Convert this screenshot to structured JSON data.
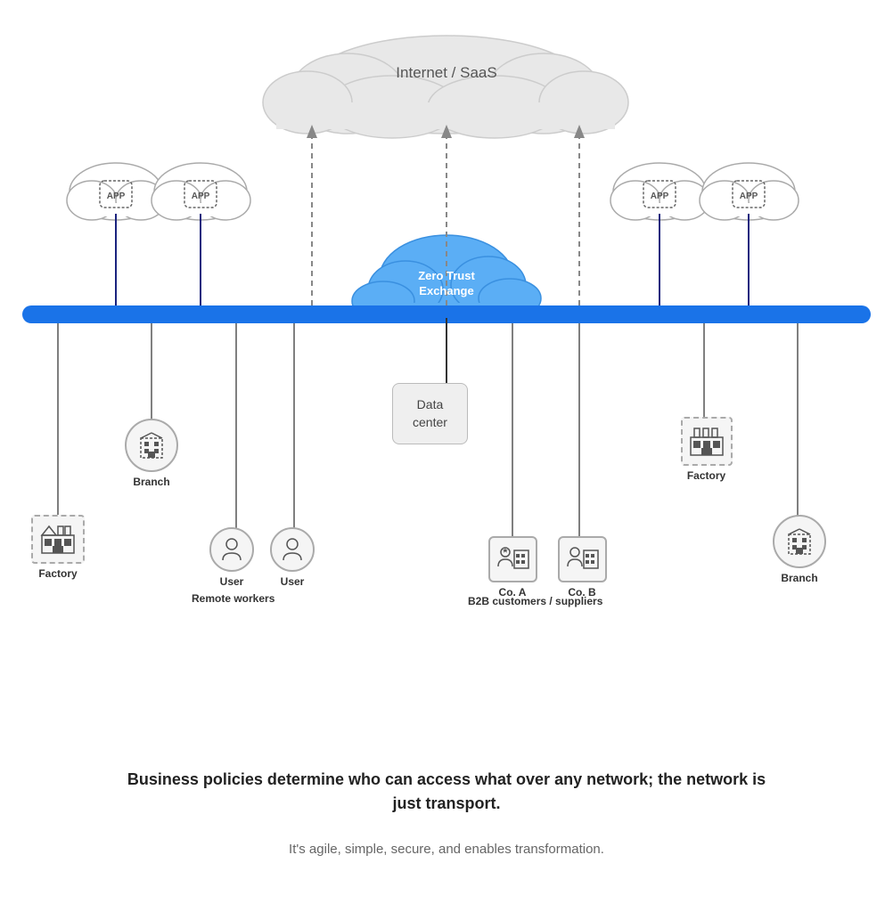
{
  "diagram": {
    "internet_label": "Internet / SaaS",
    "zte_label_line1": "Zero Trust",
    "zte_label_line2": "Exchange",
    "datacenter_label_line1": "Data",
    "datacenter_label_line2": "center",
    "nodes": {
      "branch_left": "Branch",
      "factory_left": "Factory",
      "user1": "User",
      "user2": "User",
      "remote_workers": "Remote workers",
      "co_a": "Co. A",
      "co_b": "Co. B",
      "b2b_label": "B2B customers / suppliers",
      "factory_right": "Factory",
      "branch_right": "Branch"
    },
    "bottom_bold": "Business policies determine who can access what over any network; the network is just transport.",
    "bottom_light": "It's agile, simple, secure, and enables transformation."
  }
}
